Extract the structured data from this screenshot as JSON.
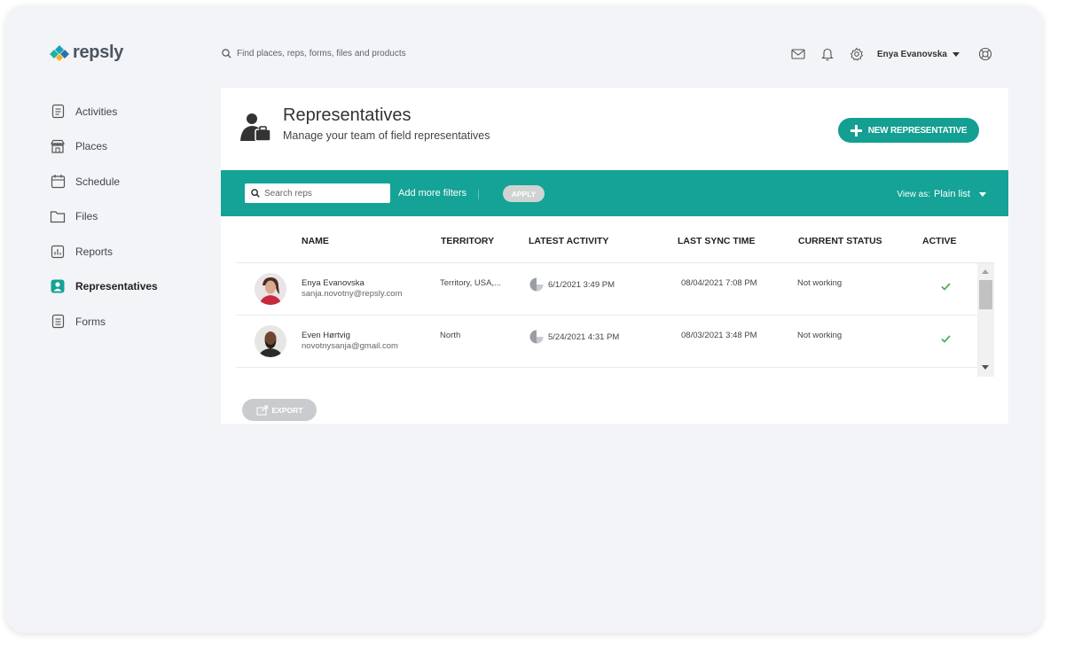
{
  "app": {
    "logo_text": "repsly"
  },
  "sidebar": {
    "items": [
      {
        "label": "Activities",
        "icon": "clipboard-icon"
      },
      {
        "label": "Places",
        "icon": "store-icon"
      },
      {
        "label": "Schedule",
        "icon": "calendar-icon"
      },
      {
        "label": "Files",
        "icon": "folder-icon"
      },
      {
        "label": "Reports",
        "icon": "chart-icon"
      },
      {
        "label": "Representatives",
        "icon": "person-icon",
        "active": true
      },
      {
        "label": "Forms",
        "icon": "form-icon"
      }
    ]
  },
  "topbar": {
    "search_placeholder": "Find places, reps, forms, files and products",
    "user_name": "Enya Evanovska"
  },
  "page": {
    "title": "Representatives",
    "subtitle": "Manage your team of field representatives",
    "new_button": "NEW REPRESENTATIVE"
  },
  "toolbar": {
    "search_placeholder": "Search reps",
    "add_filters": "Add more filters",
    "apply": "APPLY",
    "view_as_label": "View as:",
    "view_as_value": "Plain list"
  },
  "table": {
    "headers": {
      "name": "NAME",
      "territory": "TERRITORY",
      "latest_activity": "LATEST ACTIVITY",
      "last_sync": "LAST SYNC TIME",
      "status": "CURRENT STATUS",
      "active": "ACTIVE"
    },
    "rows": [
      {
        "name": "Enya Evanovska",
        "email": "sanja.novotny@repsly.com",
        "territory": "Territory, USA,...",
        "latest_activity": "6/1/2021 3:49 PM",
        "last_sync": "08/04/2021 7:08 PM",
        "status": "Not working",
        "active": true
      },
      {
        "name": "Even Hørtvig",
        "email": "novotnysanja@gmail.com",
        "territory": "North",
        "latest_activity": "5/24/2021 4:31 PM",
        "last_sync": "08/03/2021 3:48 PM",
        "status": "Not working",
        "active": true
      }
    ]
  },
  "footer": {
    "export": "EXPORT"
  },
  "colors": {
    "accent": "#14a396",
    "check": "#4caf50"
  }
}
